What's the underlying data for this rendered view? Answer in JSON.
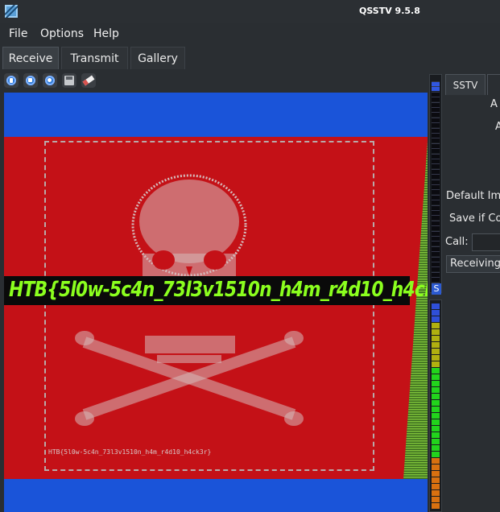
{
  "window": {
    "title": "QSSTV 9.5.8",
    "icon": "qsstv-app-icon"
  },
  "menu": {
    "file": "File",
    "options": "Options",
    "help": "Help"
  },
  "tabs": {
    "receive": "Receive",
    "transmit": "Transmit",
    "gallery": "Gallery",
    "active": "Receive"
  },
  "toolbar": {
    "icons": [
      "start-icon",
      "stop-icon",
      "resync-icon",
      "save-icon",
      "erase-icon"
    ]
  },
  "image": {
    "flag_text": "HTB{5l0w-5c4n_73l3v1510n_h4m_r4d10_h4ck3r}",
    "small_flag_text": "HTB{5l0w-5c4n_73l3v1510n_h4m_r4d10_h4ck3r}",
    "colors": {
      "blue": "#1a54d9",
      "red": "#c41117",
      "flag_green": "#8bff1e"
    }
  },
  "vu": {
    "label": "S"
  },
  "side": {
    "tab_sstv": "SSTV",
    "label_a1": "A",
    "label_a2": "A",
    "default_image": "Default Im",
    "save_if": "Save if Co",
    "call": "Call:",
    "status": "Receiving"
  }
}
